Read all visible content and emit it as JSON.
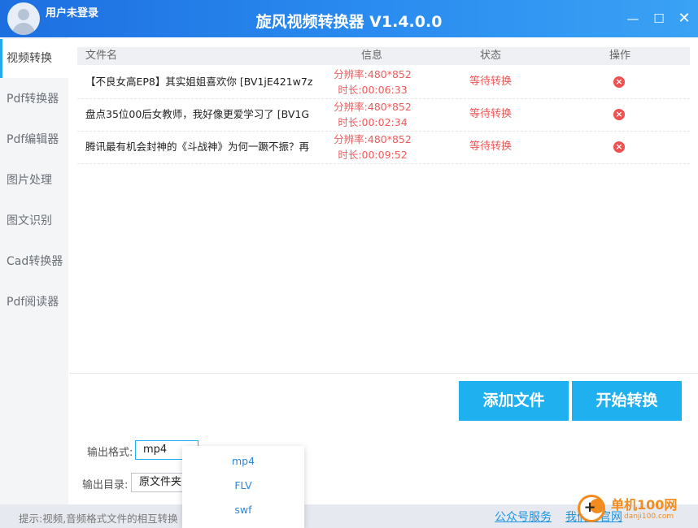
{
  "header": {
    "user_label": "用户未登录",
    "title": "旋风视频转换器 V1.4.0.0",
    "window_controls": {
      "minimize": "—",
      "maximize": "☐",
      "close": "✕"
    }
  },
  "sidebar": {
    "items": [
      {
        "label": "视频转换",
        "active": true
      },
      {
        "label": "Pdf转换器"
      },
      {
        "label": "Pdf编辑器"
      },
      {
        "label": "图片处理"
      },
      {
        "label": "图文识别"
      },
      {
        "label": "Cad转换器"
      },
      {
        "label": "Pdf阅读器"
      }
    ]
  },
  "table": {
    "columns": [
      "文件名",
      "信息",
      "状态",
      "操作"
    ],
    "rows": [
      {
        "name": "【不良女高EP8】其实姐姐喜欢你 [BV1jE421w7z",
        "resolution": "分辨率:480*852",
        "duration": "时长:00:06:33",
        "status": "等待转换"
      },
      {
        "name": "盘点35位00后女教师，我好像更爱学习了 [BV1G",
        "resolution": "分辨率:480*852",
        "duration": "时长:00:02:34",
        "status": "等待转换"
      },
      {
        "name": "腾讯最有机会封神的《斗战神》为何一蹶不振？再",
        "resolution": "分辨率:480*852",
        "duration": "时长:00:09:52",
        "status": "等待转换"
      }
    ]
  },
  "actions": {
    "add_label": "添加文件",
    "start_label": "开始转换"
  },
  "output": {
    "format_label": "输出格式:",
    "format_value": "mp4",
    "dir_label": "输出目录:",
    "dir_value": "原文件夹"
  },
  "dropdown": {
    "options": [
      "mp4",
      "FLV",
      "swf"
    ]
  },
  "footer": {
    "tip": "提示:视频,音频格式文件的相互转换",
    "link_service": "公众号服务",
    "link_contact": "我们的官网"
  },
  "watermark": {
    "text": "单机100网",
    "sub": "danji100.com"
  },
  "colors": {
    "accent": "#1fb0ef",
    "title_bar": "#2a8cf0",
    "status": "#ee5a5a",
    "link": "#1a93e0"
  }
}
